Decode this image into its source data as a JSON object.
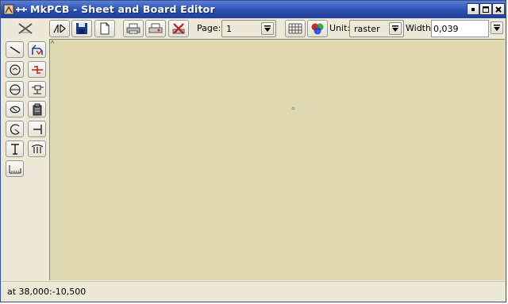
{
  "window": {
    "title": "MkPCB - Sheet and Board Editor",
    "controls": [
      "minimize-icon",
      "maximize-icon",
      "close-icon"
    ]
  },
  "toolbar": {
    "page_label": "Page:",
    "page_value": "1",
    "unit_label": "Unit:",
    "unit_value": "raster",
    "width_label": "Width:",
    "width_value": "0,039",
    "buttons": [
      "delete-tool-icon",
      "net-icon",
      "save-icon",
      "new-icon",
      "print-icon",
      "print-preview-icon",
      "clear-icon",
      "grid-icon",
      "colors-icon"
    ]
  },
  "palette": {
    "tools": [
      "line-tool-icon",
      "route-tool-icon",
      "pad-tool-icon",
      "via-tool-icon",
      "circle-tool-icon",
      "component-tool-icon",
      "polygon-tool-icon",
      "library-tool-icon",
      "arc-tool-icon",
      "connector-tool-icon",
      "text-tool-icon",
      "label-tool-icon",
      "measure-tool-icon"
    ]
  },
  "status": {
    "text": "at 38,000:-10,500"
  },
  "colors": {
    "titlebar": "#2b4fb0",
    "canvas": "#dfd8b0",
    "chrome": "#ece9d8"
  }
}
